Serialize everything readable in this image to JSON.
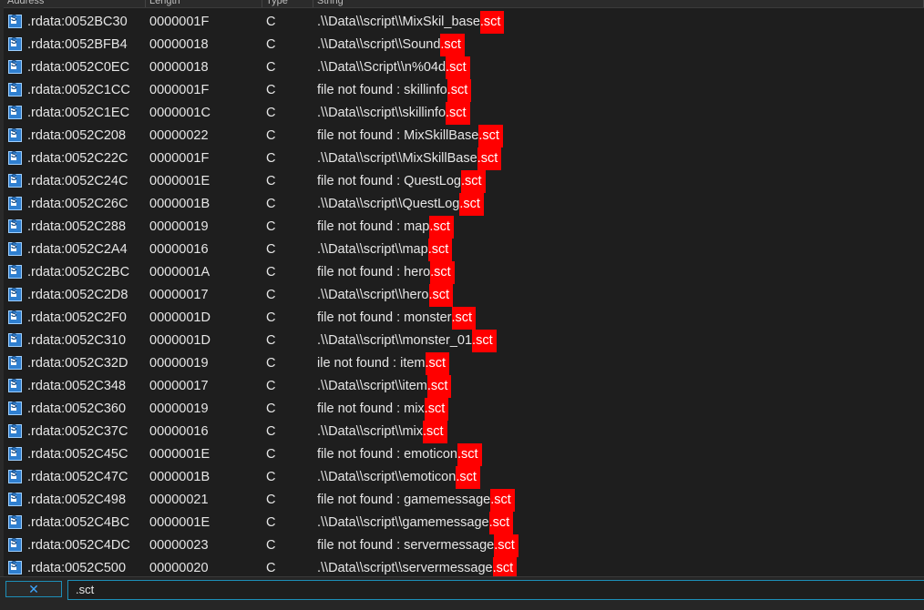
{
  "columns": {
    "address": "Address",
    "length": "Length",
    "type": "Type",
    "string": "String"
  },
  "colors": {
    "highlight": "#ff0000",
    "background": "#1e1e1e",
    "accent": "#1d8fb8"
  },
  "icons": {
    "row_icon": "string-s-icon",
    "clear_icon": "close-icon"
  },
  "rows": [
    {
      "address": ".rdata:0052BC30",
      "length": "0000001F",
      "type": "C",
      "prefix": ".\\\\Data\\\\script\\\\MixSkil_base",
      "match": ".sct"
    },
    {
      "address": ".rdata:0052BFB4",
      "length": "00000018",
      "type": "C",
      "prefix": ".\\\\Data\\\\script\\\\Sound",
      "match": ".sct"
    },
    {
      "address": ".rdata:0052C0EC",
      "length": "00000018",
      "type": "C",
      "prefix": ".\\\\Data\\\\Script\\\\n%04d",
      "match": ".sct"
    },
    {
      "address": ".rdata:0052C1CC",
      "length": "0000001F",
      "type": "C",
      "prefix": "file not found : skillinfo",
      "match": ".sct"
    },
    {
      "address": ".rdata:0052C1EC",
      "length": "0000001C",
      "type": "C",
      "prefix": ".\\\\Data\\\\script\\\\skillinfo",
      "match": ".sct"
    },
    {
      "address": ".rdata:0052C208",
      "length": "00000022",
      "type": "C",
      "prefix": "file not found : MixSkillBase",
      "match": ".sct"
    },
    {
      "address": ".rdata:0052C22C",
      "length": "0000001F",
      "type": "C",
      "prefix": ".\\\\Data\\\\script\\\\MixSkillBase",
      "match": ".sct"
    },
    {
      "address": ".rdata:0052C24C",
      "length": "0000001E",
      "type": "C",
      "prefix": "file not found : QuestLog",
      "match": ".sct"
    },
    {
      "address": ".rdata:0052C26C",
      "length": "0000001B",
      "type": "C",
      "prefix": ".\\\\Data\\\\script\\\\QuestLog",
      "match": ".sct"
    },
    {
      "address": ".rdata:0052C288",
      "length": "00000019",
      "type": "C",
      "prefix": "file not found : map",
      "match": ".sct"
    },
    {
      "address": ".rdata:0052C2A4",
      "length": "00000016",
      "type": "C",
      "prefix": ".\\\\Data\\\\script\\\\map",
      "match": ".sct"
    },
    {
      "address": ".rdata:0052C2BC",
      "length": "0000001A",
      "type": "C",
      "prefix": "file not found : hero",
      "match": ".sct"
    },
    {
      "address": ".rdata:0052C2D8",
      "length": "00000017",
      "type": "C",
      "prefix": ".\\\\Data\\\\script\\\\hero",
      "match": ".sct"
    },
    {
      "address": ".rdata:0052C2F0",
      "length": "0000001D",
      "type": "C",
      "prefix": "file not found : monster",
      "match": ".sct"
    },
    {
      "address": ".rdata:0052C310",
      "length": "0000001D",
      "type": "C",
      "prefix": ".\\\\Data\\\\script\\\\monster_01",
      "match": ".sct"
    },
    {
      "address": ".rdata:0052C32D",
      "length": "00000019",
      "type": "C",
      "prefix": "ile not found : item",
      "match": ".sct"
    },
    {
      "address": ".rdata:0052C348",
      "length": "00000017",
      "type": "C",
      "prefix": ".\\\\Data\\\\script\\\\item",
      "match": ".sct"
    },
    {
      "address": ".rdata:0052C360",
      "length": "00000019",
      "type": "C",
      "prefix": "file not found : mix",
      "match": ".sct"
    },
    {
      "address": ".rdata:0052C37C",
      "length": "00000016",
      "type": "C",
      "prefix": ".\\\\Data\\\\script\\\\mix",
      "match": ".sct"
    },
    {
      "address": ".rdata:0052C45C",
      "length": "0000001E",
      "type": "C",
      "prefix": "file not found : emoticon",
      "match": ".sct"
    },
    {
      "address": ".rdata:0052C47C",
      "length": "0000001B",
      "type": "C",
      "prefix": ".\\\\Data\\\\script\\\\emoticon",
      "match": ".sct"
    },
    {
      "address": ".rdata:0052C498",
      "length": "00000021",
      "type": "C",
      "prefix": "file not found : gamemessage",
      "match": ".sct"
    },
    {
      "address": ".rdata:0052C4BC",
      "length": "0000001E",
      "type": "C",
      "prefix": ".\\\\Data\\\\script\\\\gamemessage",
      "match": ".sct"
    },
    {
      "address": ".rdata:0052C4DC",
      "length": "00000023",
      "type": "C",
      "prefix": "file not found : servermessage",
      "match": ".sct"
    },
    {
      "address": ".rdata:0052C500",
      "length": "00000020",
      "type": "C",
      "prefix": ".\\\\Data\\\\script\\\\servermessage",
      "match": ".sct"
    }
  ],
  "filter": {
    "clear_label": "✕",
    "value": ".sct"
  }
}
